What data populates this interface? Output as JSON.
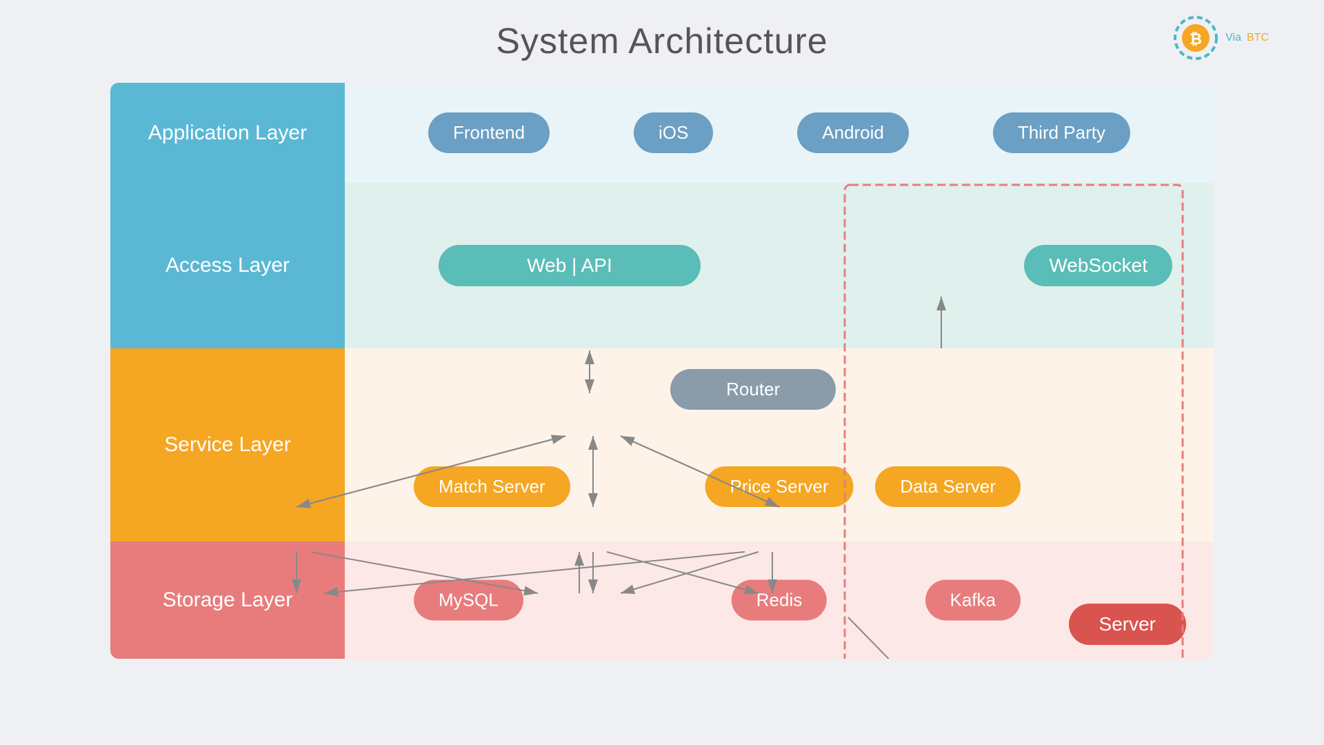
{
  "page": {
    "title": "System Architecture",
    "logo": {
      "via": "Via",
      "btc": "BTC"
    }
  },
  "layers": {
    "application": {
      "label": "Application Layer",
      "items": [
        "Frontend",
        "iOS",
        "Android",
        "Third Party"
      ]
    },
    "access": {
      "label": "Access Layer",
      "web_api": "Web  |  API",
      "websocket": "WebSocket"
    },
    "service": {
      "label": "Service Layer",
      "router": "Router",
      "match": "Match Server",
      "price": "Price Server",
      "data": "Data Server"
    },
    "storage": {
      "label": "Storage Layer",
      "mysql": "MySQL",
      "redis": "Redis",
      "kafka": "Kafka"
    },
    "server": "Server"
  }
}
